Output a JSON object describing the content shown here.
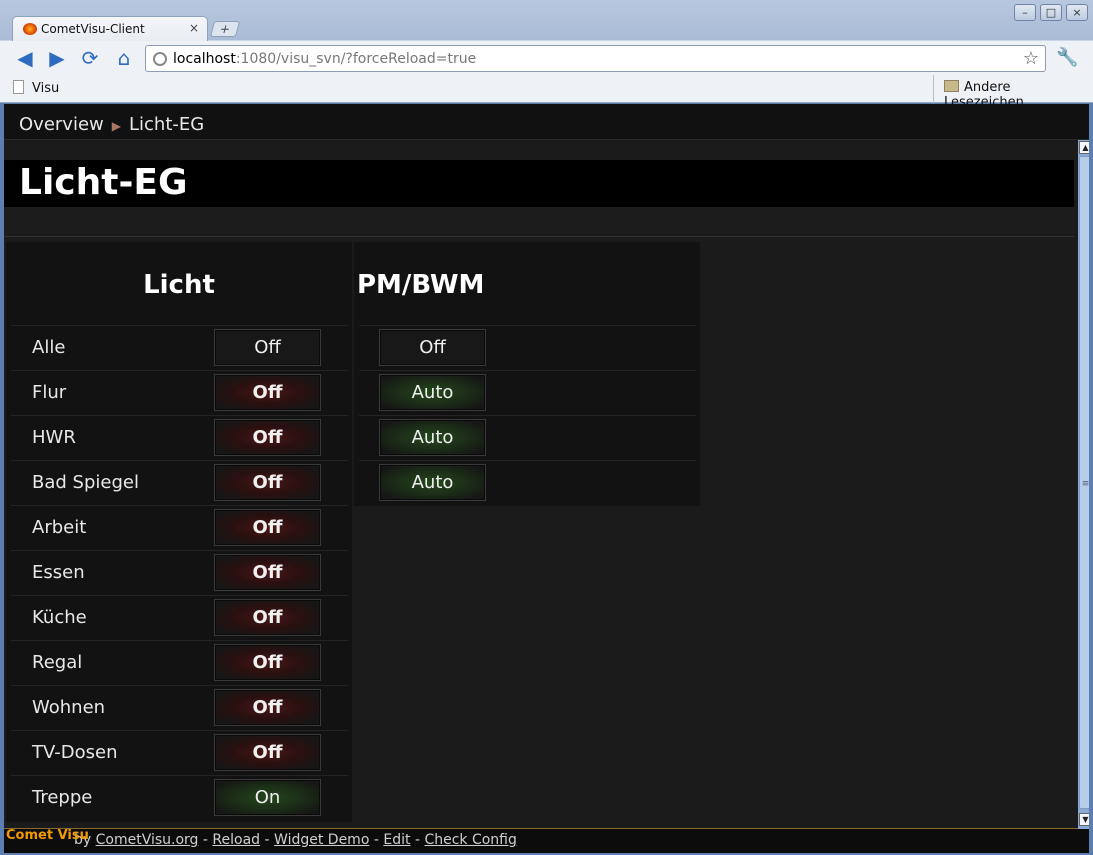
{
  "browser": {
    "tab_title": "CometVisu-Client",
    "tab_close": "×",
    "new_tab": "+",
    "url_host": "localhost",
    "url_rest": ":1080/visu_svn/?forceReload=true",
    "bookmark_visu": "Visu",
    "bookmark_other": "Andere Lesezeichen",
    "win_minimize": "–",
    "win_maximize": "□",
    "win_close": "×"
  },
  "breadcrumb": {
    "root": "Overview",
    "separator": "▶",
    "current": "Licht-EG"
  },
  "page": {
    "title": "Licht-EG"
  },
  "groups": {
    "licht": {
      "title": "Licht",
      "rows": [
        {
          "label": "Alle",
          "value": "Off",
          "state": "neutral"
        },
        {
          "label": "Flur",
          "value": "Off",
          "state": "off"
        },
        {
          "label": "HWR",
          "value": "Off",
          "state": "off"
        },
        {
          "label": "Bad Spiegel",
          "value": "Off",
          "state": "off"
        },
        {
          "label": "Arbeit",
          "value": "Off",
          "state": "off"
        },
        {
          "label": "Essen",
          "value": "Off",
          "state": "off"
        },
        {
          "label": "Küche",
          "value": "Off",
          "state": "off"
        },
        {
          "label": "Regal",
          "value": "Off",
          "state": "off"
        },
        {
          "label": "Wohnen",
          "value": "Off",
          "state": "off"
        },
        {
          "label": "TV-Dosen",
          "value": "Off",
          "state": "off"
        },
        {
          "label": "Treppe",
          "value": "On",
          "state": "on"
        }
      ]
    },
    "pmbwm": {
      "title": "PM/BWM",
      "rows": [
        {
          "value": "Off",
          "state": "neutral"
        },
        {
          "value": "Auto",
          "state": "on"
        },
        {
          "value": "Auto",
          "state": "on"
        },
        {
          "value": "Auto",
          "state": "on"
        }
      ]
    }
  },
  "footer": {
    "by": "by",
    "logo": "Comet Visu",
    "links": [
      "CometVisu.org",
      "Reload",
      "Widget Demo",
      "Edit",
      "Check Config"
    ],
    "sep": "-"
  },
  "colors": {
    "off_glow": "#4a1717",
    "on_glow": "#24471c",
    "page_bg": "#1b1b1b"
  }
}
